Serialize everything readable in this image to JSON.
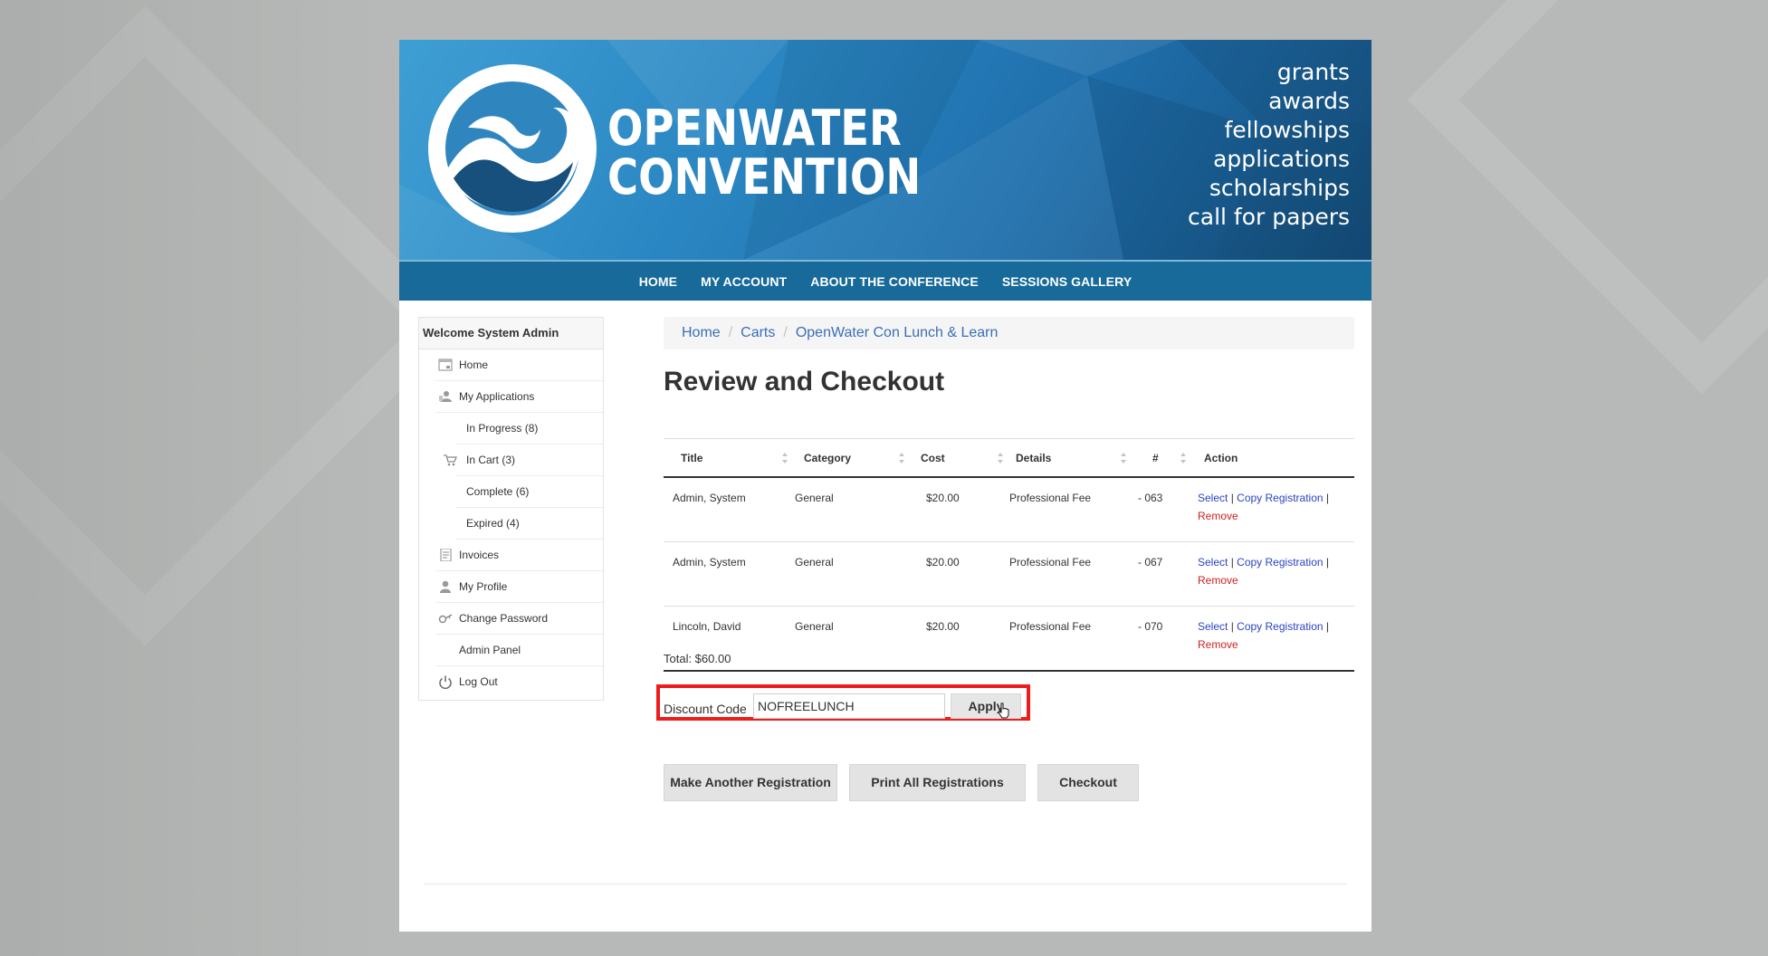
{
  "banner": {
    "brand_line1": "OPENWATER",
    "brand_line2": "CONVENTION",
    "taglines": [
      "grants",
      "awards",
      "fellowships",
      "applications",
      "scholarships",
      "call for papers"
    ]
  },
  "nav": {
    "items": [
      "HOME",
      "MY ACCOUNT",
      "ABOUT THE CONFERENCE",
      "SESSIONS GALLERY"
    ]
  },
  "sidebar": {
    "welcome": "Welcome System Admin",
    "items": [
      {
        "label": "Home",
        "icon": "calendar-icon"
      },
      {
        "label": "My Applications",
        "icon": "user-icon"
      },
      {
        "label": "In Progress (8)",
        "icon": ""
      },
      {
        "label": "In Cart (3)",
        "icon": "cart-icon"
      },
      {
        "label": "Complete (6)",
        "icon": ""
      },
      {
        "label": "Expired (4)",
        "icon": ""
      },
      {
        "label": "Invoices",
        "icon": "invoice-icon"
      },
      {
        "label": "My Profile",
        "icon": "profile-icon"
      },
      {
        "label": "Change Password",
        "icon": "key-icon"
      },
      {
        "label": "Admin Panel",
        "icon": ""
      },
      {
        "label": "Log Out",
        "icon": "power-icon"
      }
    ]
  },
  "breadcrumb": {
    "home": "Home",
    "carts": "Carts",
    "current": "OpenWater Con Lunch & Learn",
    "separator": "/"
  },
  "page_title": "Review and Checkout",
  "table": {
    "headers": [
      "Title",
      "Category",
      "Cost",
      "Details",
      "#",
      "Action"
    ],
    "rows": [
      {
        "title": "Admin, System",
        "category": "General",
        "cost": "$20.00",
        "details": "Professional Fee",
        "num": "- 063"
      },
      {
        "title": "Admin, System",
        "category": "General",
        "cost": "$20.00",
        "details": "Professional Fee",
        "num": "- 067"
      },
      {
        "title": "Lincoln, David",
        "category": "General",
        "cost": "$20.00",
        "details": "Professional Fee",
        "num": "- 070"
      }
    ],
    "action_select": "Select",
    "action_copy": "Copy Registration",
    "action_remove": "Remove",
    "action_sep": "|"
  },
  "total": "Total: $60.00",
  "discount": {
    "label": "Discount Code",
    "value": "NOFREELUNCH",
    "apply": "Apply"
  },
  "buttons": {
    "another": "Make Another Registration",
    "print": "Print All Registrations",
    "checkout": "Checkout"
  },
  "colors": {
    "nav": "#176a9a",
    "link": "#2b44c2",
    "remove": "#d01f1f",
    "highlight": "#ee1c1c"
  }
}
